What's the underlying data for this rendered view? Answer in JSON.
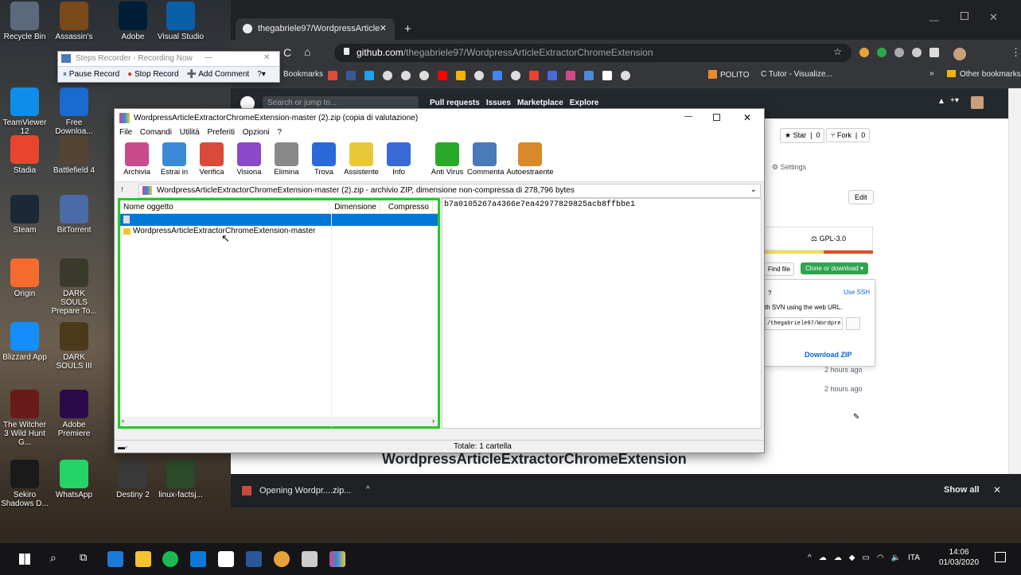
{
  "desktop": {
    "icons": [
      {
        "label": "Recycle Bin",
        "color": "#5a6a7a"
      },
      {
        "label": "Assassin's",
        "color": "#7a4a1a"
      },
      {
        "label": "Adobe",
        "color": "#001e36"
      },
      {
        "label": "Visual Studio",
        "color": "#0a5fa8"
      },
      {
        "label": "TeamViewer 12",
        "color": "#0e8ee9"
      },
      {
        "label": "Free Downloa...",
        "color": "#1a6ad0"
      },
      {
        "label": "Stadia",
        "color": "#e8452c"
      },
      {
        "label": "Battlefield 4",
        "color": "#554433"
      },
      {
        "label": "Steam",
        "color": "#1b2838"
      },
      {
        "label": "BitTorrent",
        "color": "#4a6aa8"
      },
      {
        "label": "Origin",
        "color": "#f56c2d"
      },
      {
        "label": "DARK SOULS Prepare To...",
        "color": "#3a3a2a"
      },
      {
        "label": "Blizzard App",
        "color": "#148eff"
      },
      {
        "label": "DARK SOULS III",
        "color": "#4a3a1a"
      },
      {
        "label": "The Witcher 3 Wild Hunt G...",
        "color": "#6a1a1a"
      },
      {
        "label": "Adobe Premiere",
        "color": "#2a0a4a"
      },
      {
        "label": "Sekiro Shadows D...",
        "color": "#1a1a1a"
      },
      {
        "label": "WhatsApp",
        "color": "#25d366"
      },
      {
        "label": "Destiny 2",
        "color": "#3a3a3a"
      },
      {
        "label": "linux-factsj...",
        "color": "#2a4a2a"
      }
    ]
  },
  "steps_recorder": {
    "title": "Steps Recorder - Recording Now",
    "pause": "Pause Record",
    "stop": "Stop Record",
    "comment": "Add Comment"
  },
  "chrome": {
    "tab_title": "thegabriele97/WordpressArticle",
    "url_host": "github.com",
    "url_path": "/thegabriele97/WordpressArticleExtractorChromeExtension",
    "bookmarks_label": "Bookmarks",
    "polito": "POLITO",
    "ctutor": "C Tutor - Visualize...",
    "other": "Other bookmarks"
  },
  "github": {
    "search_placeholder": "Search or jump to...",
    "nav": [
      "Pull requests",
      "Issues",
      "Marketplace",
      "Explore"
    ],
    "star": "Star",
    "star_count": "0",
    "fork": "Fork",
    "fork_count": "0",
    "settings": "Settings",
    "edit": "Edit",
    "license": "GPL-3.0",
    "find_file": "Find file",
    "clone": "Clone or download",
    "use_ssh": "Use SSH",
    "svn_text": "th SVN using the web URL.",
    "clone_url": "/thegabriele97/Wordpre",
    "download_zip": "Download ZIP",
    "time1": "2 hours ago",
    "time2": "2 hours ago",
    "repo_heading": "WordpressArticleExtractorChromeExtension"
  },
  "download": {
    "file": "Opening Wordpr....zip...",
    "show_all": "Show all"
  },
  "winrar": {
    "title": "WordpressArticleExtractorChromeExtension-master (2).zip (copia di valutazione)",
    "menu": [
      "File",
      "Comandi",
      "Utilità",
      "Preferiti",
      "Opzioni",
      "?"
    ],
    "toolbar": [
      {
        "label": "Archivia",
        "color": "#c84a8a"
      },
      {
        "label": "Estrai in",
        "color": "#3a8ad8"
      },
      {
        "label": "Verifica",
        "color": "#d84a3a"
      },
      {
        "label": "Visiona",
        "color": "#8a4ac8"
      },
      {
        "label": "Elimina",
        "color": "#888888"
      },
      {
        "label": "Trova",
        "color": "#2a6ad8"
      },
      {
        "label": "Assistente",
        "color": "#e8c83a"
      },
      {
        "label": "Info",
        "color": "#3a6ad8"
      },
      {
        "label": "Anti Virus",
        "color": "#2aa82a"
      },
      {
        "label": "Commenta",
        "color": "#4a7ab8"
      },
      {
        "label": "Autoestraente",
        "color": "#d88a2a"
      }
    ],
    "path": "WordpressArticleExtractorChromeExtension-master (2).zip - archivio ZIP, dimensione non-compressa di 278,796 bytes",
    "columns": [
      "Nome oggetto",
      "Dimensione",
      "Compresso"
    ],
    "rows": [
      {
        "name": ""
      },
      {
        "name": "WordpressArticleExtractorChromeExtension-master"
      }
    ],
    "hash": "b7a0105267a4366e7ea42977829825acb8ffbbe1",
    "status": "Totale: 1 cartella"
  },
  "taskbar": {
    "lang": "ITA",
    "time": "14:06",
    "date": "01/03/2020"
  }
}
